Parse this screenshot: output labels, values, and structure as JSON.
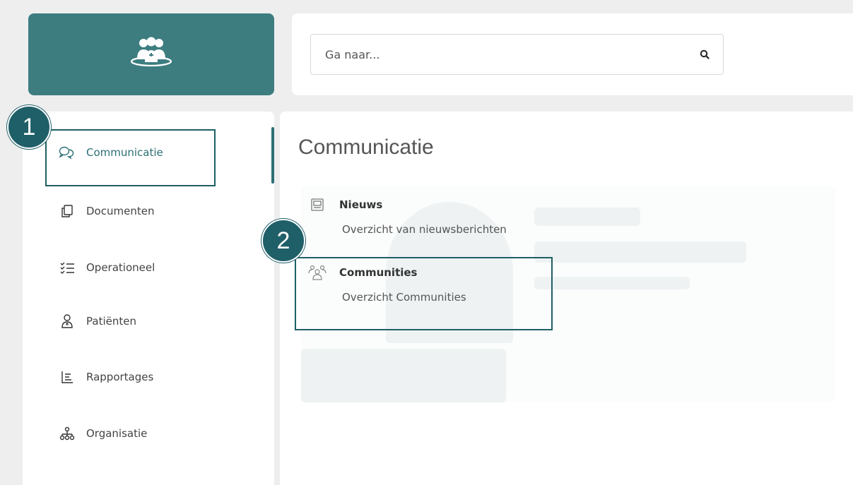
{
  "search": {
    "placeholder": "Ga naar..."
  },
  "sidebar": {
    "items": [
      {
        "label": "Communicatie",
        "icon": "chat-bubbles-icon",
        "active": true
      },
      {
        "label": "Documenten",
        "icon": "documents-icon",
        "active": false
      },
      {
        "label": "Operationeel",
        "icon": "checklist-icon",
        "active": false
      },
      {
        "label": "Patiënten",
        "icon": "patient-icon",
        "active": false
      },
      {
        "label": "Rapportages",
        "icon": "report-icon",
        "active": false
      },
      {
        "label": "Organisatie",
        "icon": "org-chart-icon",
        "active": false
      }
    ]
  },
  "main": {
    "title": "Communicatie",
    "items": [
      {
        "title": "Nieuws",
        "description": "Overzicht van nieuwsberichten",
        "icon": "newspaper-icon"
      },
      {
        "title": "Communities",
        "description": "Overzicht Communities",
        "icon": "people-group-icon"
      }
    ]
  },
  "callouts": {
    "one": "1",
    "two": "2"
  },
  "colors": {
    "brand": "#3d7d80",
    "accent": "#2c6f74",
    "callout": "#1f5f68"
  }
}
